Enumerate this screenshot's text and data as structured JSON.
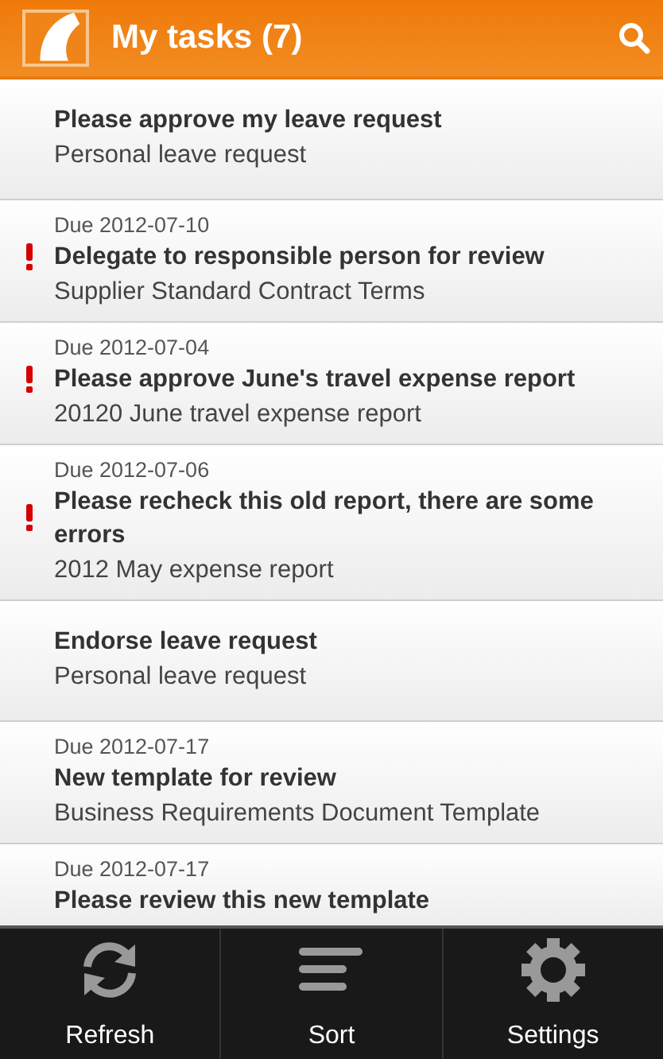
{
  "header": {
    "title": "My tasks (7)"
  },
  "tasks": [
    {
      "title": "Please approve my leave request",
      "subtitle": "Personal leave request",
      "urgent": false
    },
    {
      "due": "Due 2012-07-10",
      "title": "Delegate to responsible person for review",
      "subtitle": "Supplier Standard Contract Terms",
      "urgent": true
    },
    {
      "due": "Due 2012-07-04",
      "title": "Please approve June's travel expense report",
      "subtitle": "20120 June travel expense report",
      "urgent": true
    },
    {
      "due": "Due 2012-07-06",
      "title": "Please recheck this old report, there are some errors",
      "subtitle": "2012 May expense report",
      "urgent": true
    },
    {
      "title": "Endorse leave request",
      "subtitle": "Personal leave request",
      "urgent": false
    },
    {
      "due": "Due 2012-07-17",
      "title": "New template for review",
      "subtitle": "Business Requirements Document Template",
      "urgent": false
    },
    {
      "due": "Due 2012-07-17",
      "title": "Please review this new template",
      "urgent": false
    }
  ],
  "menu": [
    {
      "label": "Refresh",
      "kind": "refresh"
    },
    {
      "label": "Sort",
      "kind": "sort"
    },
    {
      "label": "Settings",
      "kind": "settings"
    }
  ]
}
